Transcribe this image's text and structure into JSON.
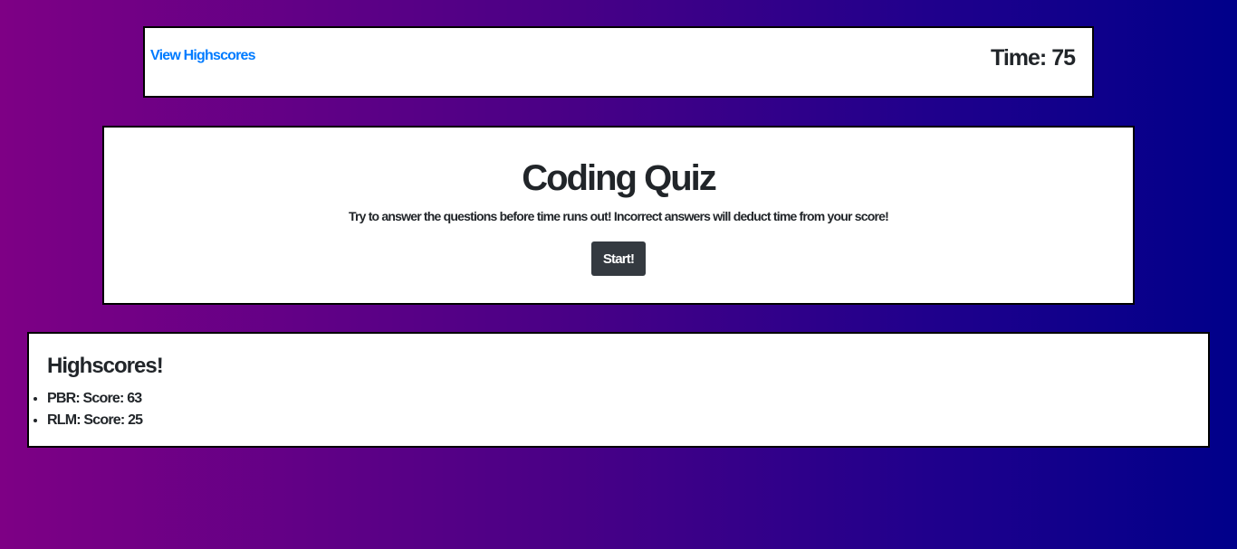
{
  "header": {
    "highscores_link": "View Highscores",
    "timer_label": "Time: ",
    "timer_value": "75"
  },
  "quiz": {
    "title": "Coding Quiz",
    "instructions": "Try to answer the questions before time runs out! Incorrect answers will deduct time from your score!",
    "start_label": "Start!"
  },
  "highscores": {
    "title": "Highscores!",
    "entries": [
      {
        "text": "PBR: Score: 63"
      },
      {
        "text": "RLM: Score: 25"
      }
    ]
  },
  "colors": {
    "link": "#007bff",
    "button_bg": "#343a40",
    "gradient_left": "#7e0085",
    "gradient_right": "#00008a"
  }
}
